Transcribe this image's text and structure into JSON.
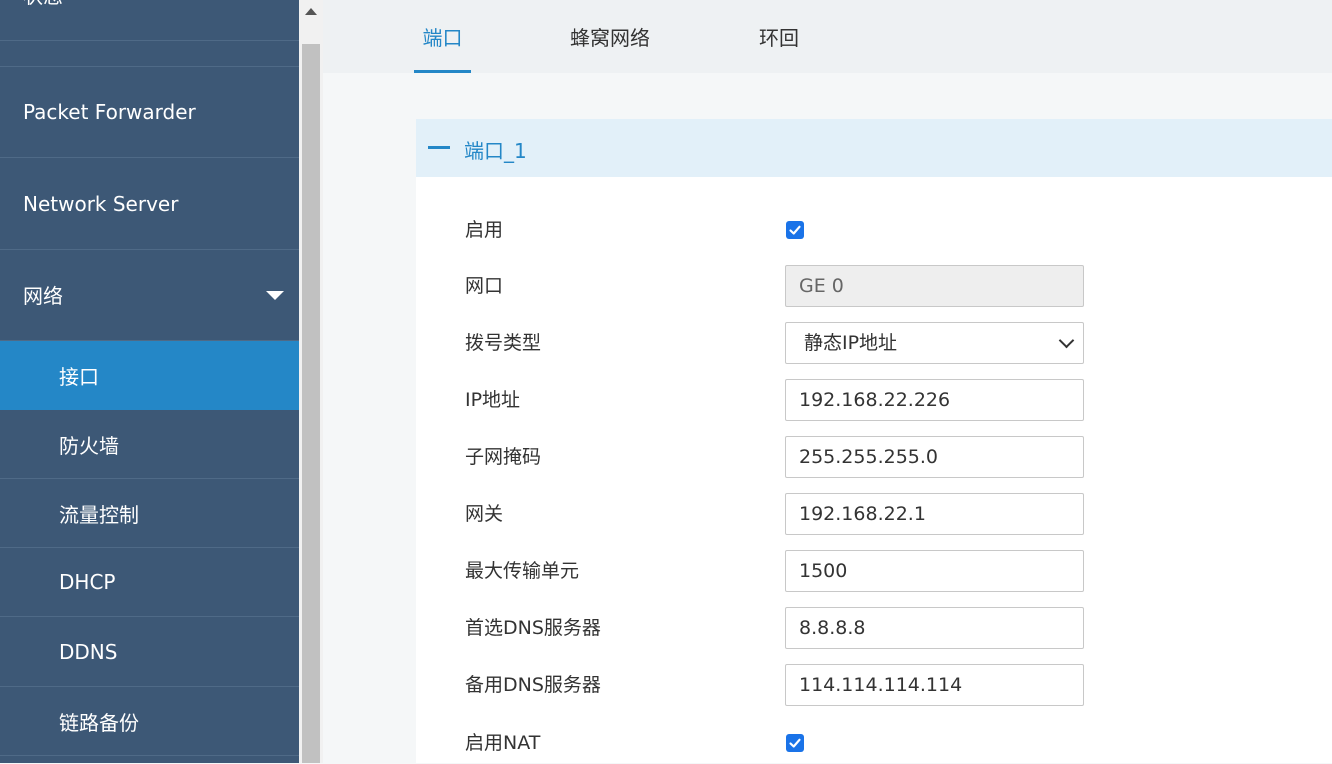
{
  "sidebar": {
    "items": [
      {
        "label": "状态"
      },
      {
        "label": "Packet Forwarder"
      },
      {
        "label": "Network Server"
      },
      {
        "label": "网络"
      }
    ],
    "sub_items": [
      {
        "label": "接口",
        "active": true
      },
      {
        "label": "防火墙"
      },
      {
        "label": "流量控制"
      },
      {
        "label": "DHCP"
      },
      {
        "label": "DDNS"
      },
      {
        "label": "链路备份"
      }
    ]
  },
  "tabs": [
    {
      "label": "端口",
      "active": true
    },
    {
      "label": "蜂窝网络"
    },
    {
      "label": "环回"
    }
  ],
  "panel": {
    "title": "端口_1",
    "fields": {
      "enable": {
        "label": "启用",
        "checked": true
      },
      "port": {
        "label": "网口",
        "value": "GE 0"
      },
      "dial_type": {
        "label": "拨号类型",
        "value": "静态IP地址"
      },
      "ip": {
        "label": "IP地址",
        "value": "192.168.22.226"
      },
      "netmask": {
        "label": "子网掩码",
        "value": "255.255.255.0"
      },
      "gateway": {
        "label": "网关",
        "value": "192.168.22.1"
      },
      "mtu": {
        "label": "最大传输单元",
        "value": "1500"
      },
      "dns1": {
        "label": "首选DNS服务器",
        "value": "8.8.8.8"
      },
      "dns2": {
        "label": "备用DNS服务器",
        "value": "114.114.114.114"
      },
      "nat": {
        "label": "启用NAT",
        "checked": true
      }
    }
  },
  "colors": {
    "sidebar_bg": "#3d5876",
    "active_bg": "#2487c7",
    "accent": "#2487c7",
    "checkbox": "#1a73e8"
  }
}
